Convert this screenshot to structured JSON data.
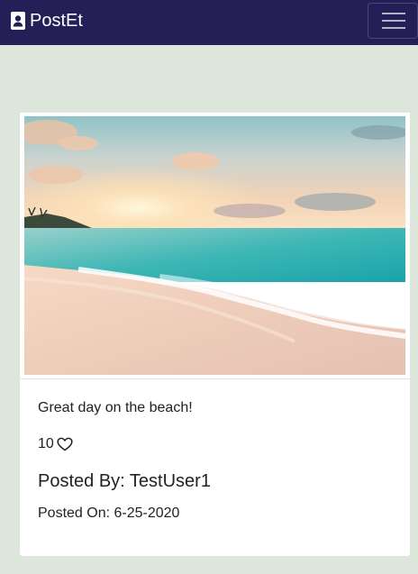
{
  "navbar": {
    "brand_icon": "contact-card-icon",
    "brand": "PostEt",
    "menu_icon": "hamburger-menu-icon",
    "background": "#241f57"
  },
  "post": {
    "image_subject": "beach-sunset-photo",
    "caption": "Great day on the beach!",
    "likes": "10",
    "like_icon": "heart-outline-icon",
    "posted_by": "Posted By: TestUser1",
    "posted_on": "Posted On: 6-25-2020"
  },
  "colors": {
    "page_background": "#dce6da",
    "card_background": "#ffffff",
    "text": "#222222"
  }
}
